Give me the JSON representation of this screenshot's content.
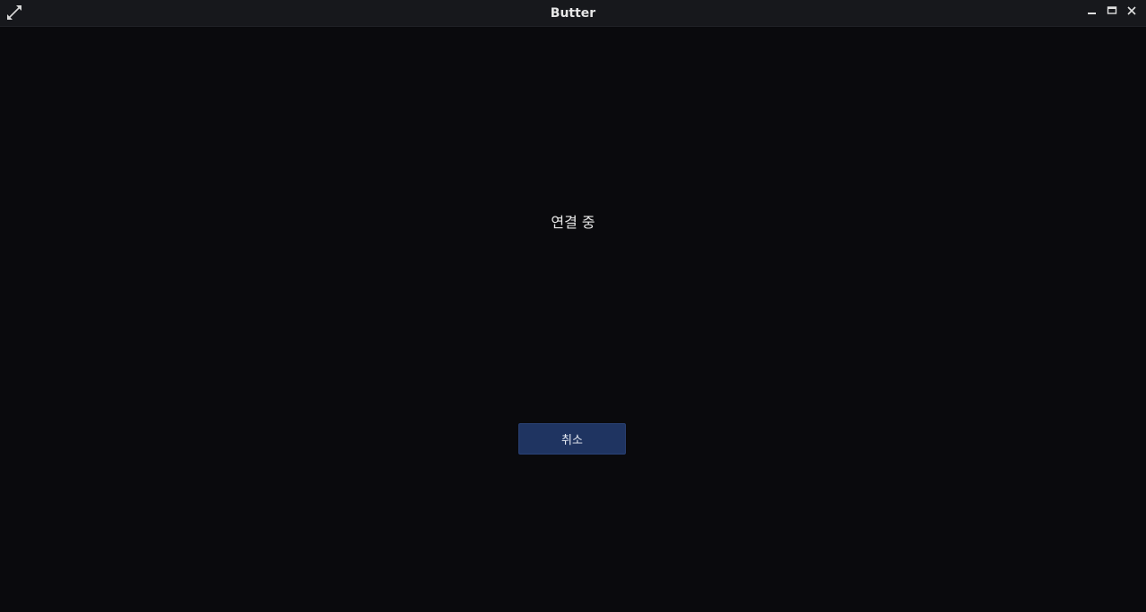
{
  "window": {
    "title": "Butter",
    "controls": {
      "minimize_icon": "minimize-icon",
      "maximize_icon": "maximize-icon",
      "close_icon": "close-icon"
    },
    "expand_icon": "expand-arrows-icon"
  },
  "main": {
    "status_text": "연결 중",
    "cancel_label": "취소"
  },
  "colors": {
    "background": "#0a0a0d",
    "titlebar": "#17181c",
    "button_bg": "#1f3461",
    "text": "#e8e8e8"
  }
}
